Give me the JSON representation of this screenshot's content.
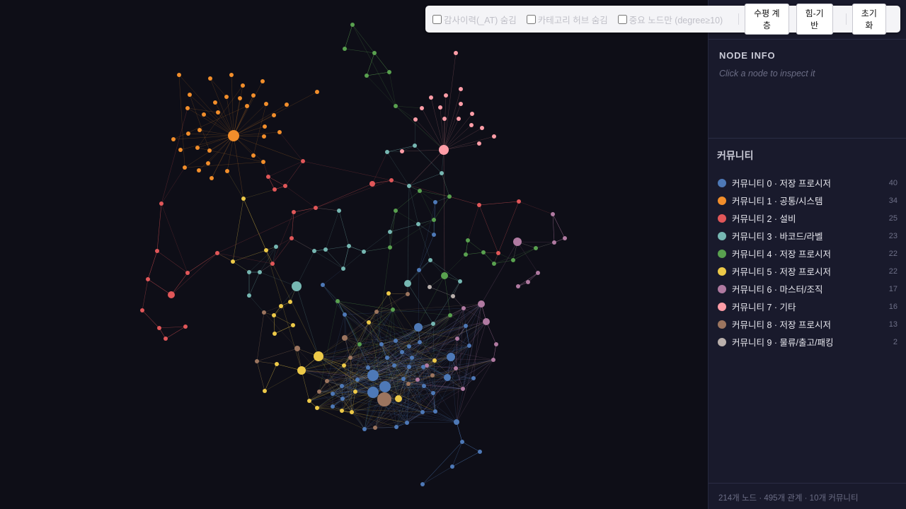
{
  "toolbar": {
    "checkbox_attractor": "감사이력(_AT) 숨김",
    "checkbox_category_hub": "카테고리 허브 숨김",
    "checkbox_important": "중요 노드만 (degree≥10)",
    "btn_horizontal": "수평 계층",
    "btn_force": "힘-기반",
    "btn_reset": "초기화"
  },
  "node_info": {
    "title": "NODE INFO",
    "hint": "Click a node to inspect it"
  },
  "communities": {
    "title": "커뮤니티",
    "items": [
      {
        "label": "커뮤니티 0 · 저장 프로시저",
        "count": "40",
        "color": "#4e79b7"
      },
      {
        "label": "커뮤니티 1 · 공통/시스템",
        "count": "34",
        "color": "#f28e2b"
      },
      {
        "label": "커뮤니티 2 · 설비",
        "count": "25",
        "color": "#e15759"
      },
      {
        "label": "커뮤니티 3 · 바코드/라벨",
        "count": "23",
        "color": "#76b7b2"
      },
      {
        "label": "커뮤니티 4 · 저장 프로시저",
        "count": "22",
        "color": "#59a14f"
      },
      {
        "label": "커뮤니티 5 · 저장 프로시저",
        "count": "22",
        "color": "#edc948"
      },
      {
        "label": "커뮤니티 6 · 마스터/조직",
        "count": "17",
        "color": "#b07aa1"
      },
      {
        "label": "커뮤니티 7 · 기타",
        "count": "16",
        "color": "#ff9da7"
      },
      {
        "label": "커뮤니티 8 · 저장 프로시저",
        "count": "13",
        "color": "#9c755f"
      },
      {
        "label": "커뮤니티 9 · 물류/출고/패킹",
        "count": "2",
        "color": "#bab0ac"
      }
    ]
  },
  "footer": {
    "stats": "214개 노드 · 495개 관계 · 10개 커뮤니티"
  }
}
